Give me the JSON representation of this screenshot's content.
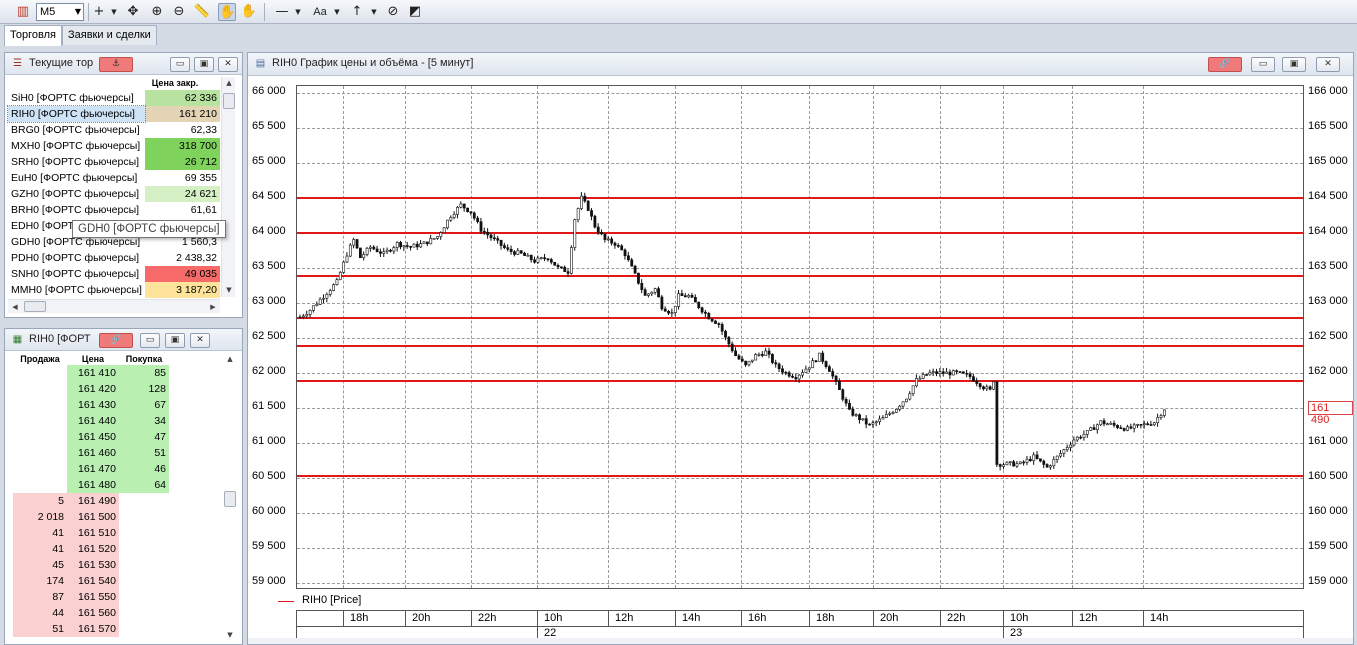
{
  "toolbar": {
    "timeframe": "M5",
    "text_tool_label": "Aa"
  },
  "tabs": [
    {
      "label": "Торговля",
      "active": true
    },
    {
      "label": "Заявки и сделки",
      "active": false
    }
  ],
  "quotes_panel": {
    "title": "Текущие тор",
    "column_header": "Цена закр.",
    "rows": [
      {
        "name": "SiH0 [ФОРТС фьючерсы]",
        "price": "62 336",
        "bg": "#b8e2a0",
        "selected": false
      },
      {
        "name": "RIH0 [ФОРТС фьючерсы]",
        "price": "161 210",
        "bg": "#e2d4b4",
        "selected": true
      },
      {
        "name": "BRG0 [ФОРТС фьючерсы]",
        "price": "62,33",
        "bg": "#ffffff",
        "selected": false
      },
      {
        "name": "MXH0 [ФОРТС фьючерсы]",
        "price": "318 700",
        "bg": "#7fd35c",
        "selected": false
      },
      {
        "name": "SRH0 [ФОРТС фьючерсы]",
        "price": "26 712",
        "bg": "#7fd35c",
        "selected": false
      },
      {
        "name": "EuH0 [ФОРТС фьючерсы]",
        "price": "69 355",
        "bg": "#ffffff",
        "selected": false
      },
      {
        "name": "GZH0 [ФОРТС фьючерсы]",
        "price": "24 621",
        "bg": "#d6f0c6",
        "selected": false
      },
      {
        "name": "BRH0 [ФОРТС фьючерсы]",
        "price": "61,61",
        "bg": "#ffffff",
        "selected": false
      },
      {
        "name": "EDH0 [ФОРТС фьючерсы]",
        "price": "",
        "bg": "#ffffff",
        "selected": false
      },
      {
        "name": "GDH0 [ФОРТС фьючерсы]",
        "price": "1 560,3",
        "bg": "#ffffff",
        "selected": false
      },
      {
        "name": "PDH0 [ФОРТС фьючерсы]",
        "price": "2 438,32",
        "bg": "#ffffff",
        "selected": false
      },
      {
        "name": "SNH0 [ФОРТС фьючерсы]",
        "price": "49 035",
        "bg": "#f66a6a",
        "selected": false
      },
      {
        "name": "MMH0 [ФОРТС фьючерсы]",
        "price": "3 187,20",
        "bg": "#fde49a",
        "selected": false
      }
    ],
    "tooltip": "GDH0 [ФОРТС фьючерсы]"
  },
  "orderbook_panel": {
    "title": "RIH0 [ФОРТ",
    "headers": {
      "sell": "Продажа",
      "price": "Цена",
      "buy": "Покупка"
    },
    "rows": [
      {
        "sell": "",
        "price": "161 410",
        "buy": "85"
      },
      {
        "sell": "",
        "price": "161 420",
        "buy": "128"
      },
      {
        "sell": "",
        "price": "161 430",
        "buy": "67"
      },
      {
        "sell": "",
        "price": "161 440",
        "buy": "34"
      },
      {
        "sell": "",
        "price": "161 450",
        "buy": "47"
      },
      {
        "sell": "",
        "price": "161 460",
        "buy": "51"
      },
      {
        "sell": "",
        "price": "161 470",
        "buy": "46"
      },
      {
        "sell": "",
        "price": "161 480",
        "buy": "64"
      },
      {
        "sell": "5",
        "price": "161 490",
        "buy": ""
      },
      {
        "sell": "2 018",
        "price": "161 500",
        "buy": ""
      },
      {
        "sell": "41",
        "price": "161 510",
        "buy": ""
      },
      {
        "sell": "41",
        "price": "161 520",
        "buy": ""
      },
      {
        "sell": "45",
        "price": "161 530",
        "buy": ""
      },
      {
        "sell": "174",
        "price": "161 540",
        "buy": ""
      },
      {
        "sell": "87",
        "price": "161 550",
        "buy": ""
      },
      {
        "sell": "44",
        "price": "161 560",
        "buy": ""
      },
      {
        "sell": "51",
        "price": "161 570",
        "buy": ""
      }
    ]
  },
  "chart_panel": {
    "title": "RIH0 График цены и объёма - [5 минут]",
    "legend": "RIH0 [Price]",
    "current_price_tag": "161 490"
  },
  "chart_data": {
    "type": "candlestick",
    "left_axis": {
      "ticks": [
        "66 000",
        "65 500",
        "65 000",
        "64 500",
        "64 000",
        "63 500",
        "63 000",
        "62 500",
        "62 000",
        "61 500",
        "61 000",
        "60 500",
        "60 000",
        "59 500",
        "59 000"
      ],
      "range": [
        58900,
        66100
      ]
    },
    "right_axis": {
      "ticks": [
        "166 000",
        "165 500",
        "165 000",
        "164 500",
        "164 000",
        "163 500",
        "163 000",
        "162 500",
        "162 000",
        "161 500",
        "161 000",
        "160 500",
        "160 000",
        "159 500",
        "159 000"
      ],
      "range": [
        158900,
        166100
      ]
    },
    "x_hours": [
      "18h",
      "20h",
      "22h",
      "10h",
      "12h",
      "14h",
      "16h",
      "18h",
      "20h",
      "22h",
      "10h",
      "12h",
      "14h"
    ],
    "x_days": [
      {
        "label": "22",
        "at_hour_index": 3
      },
      {
        "label": "23",
        "at_hour_index": 10
      }
    ],
    "horizontal_levels_right": [
      164500,
      164000,
      163390,
      162780,
      162390,
      161890,
      160530
    ],
    "last_price": 161490,
    "price_path": [
      [
        0,
        162800
      ],
      [
        3,
        162900
      ],
      [
        7,
        163100
      ],
      [
        11,
        163300
      ],
      [
        14,
        163700
      ],
      [
        16,
        163900
      ],
      [
        18,
        163650
      ],
      [
        21,
        163800
      ],
      [
        25,
        163700
      ],
      [
        29,
        163850
      ],
      [
        33,
        163800
      ],
      [
        37,
        163850
      ],
      [
        41,
        163950
      ],
      [
        45,
        164250
      ],
      [
        48,
        164400
      ],
      [
        51,
        164300
      ],
      [
        54,
        164050
      ],
      [
        58,
        163900
      ],
      [
        62,
        163750
      ],
      [
        66,
        163700
      ],
      [
        70,
        163600
      ],
      [
        74,
        163650
      ],
      [
        77,
        163500
      ],
      [
        80,
        163450
      ],
      [
        82,
        164200
      ],
      [
        84,
        164500
      ],
      [
        86,
        164350
      ],
      [
        88,
        164100
      ],
      [
        91,
        163900
      ],
      [
        94,
        163850
      ],
      [
        97,
        163700
      ],
      [
        100,
        163400
      ],
      [
        103,
        163100
      ],
      [
        106,
        163200
      ],
      [
        108,
        162950
      ],
      [
        111,
        162850
      ],
      [
        113,
        163100
      ],
      [
        116,
        163100
      ],
      [
        119,
        162950
      ],
      [
        122,
        162800
      ],
      [
        125,
        162700
      ],
      [
        127,
        162500
      ],
      [
        130,
        162250
      ],
      [
        133,
        162100
      ],
      [
        136,
        162250
      ],
      [
        139,
        162300
      ],
      [
        142,
        162100
      ],
      [
        145,
        162000
      ],
      [
        148,
        161950
      ],
      [
        152,
        162100
      ],
      [
        155,
        162250
      ],
      [
        158,
        162050
      ],
      [
        161,
        161750
      ],
      [
        164,
        161450
      ],
      [
        167,
        161350
      ],
      [
        170,
        161250
      ],
      [
        174,
        161350
      ],
      [
        178,
        161500
      ],
      [
        181,
        161650
      ],
      [
        184,
        161900
      ],
      [
        188,
        162000
      ],
      [
        192,
        162000
      ],
      [
        196,
        162000
      ],
      [
        200,
        161950
      ],
      [
        204,
        161800
      ],
      [
        206,
        161750
      ],
      [
        207,
        161900
      ],
      [
        208,
        160700
      ],
      [
        211,
        160700
      ],
      [
        215,
        160700
      ],
      [
        219,
        160800
      ],
      [
        223,
        160650
      ],
      [
        227,
        160850
      ],
      [
        231,
        161050
      ],
      [
        235,
        161150
      ],
      [
        239,
        161300
      ],
      [
        243,
        161250
      ],
      [
        247,
        161200
      ],
      [
        251,
        161250
      ],
      [
        255,
        161300
      ],
      [
        258,
        161490
      ]
    ]
  }
}
